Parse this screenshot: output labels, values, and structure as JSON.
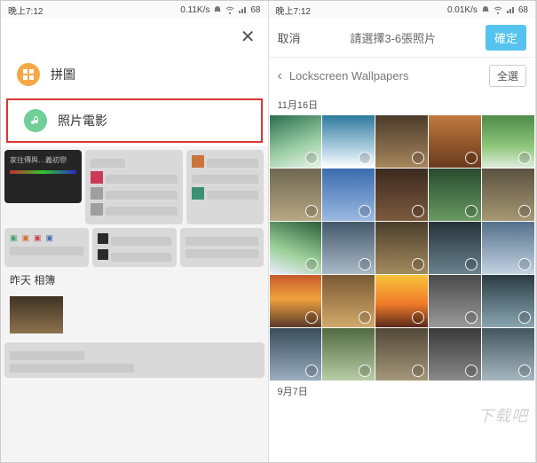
{
  "status": {
    "time": "晚上7:12",
    "speed_left": "0.11K/s",
    "speed_right": "0.01K/s",
    "battery": "68",
    "icons": [
      "do-not-disturb-icon",
      "wifi-icon",
      "signal-icon"
    ]
  },
  "left": {
    "close": "✕",
    "options": [
      {
        "key": "collage",
        "label": "拼圖",
        "icon_color": "orange",
        "icon": "grid-icon",
        "highlighted": false
      },
      {
        "key": "movie",
        "label": "照片電影",
        "icon_color": "green",
        "icon": "music-note-icon",
        "highlighted": true
      }
    ],
    "bg_section": "昨天 相簿"
  },
  "right": {
    "header": {
      "cancel": "取消",
      "title": "請選擇3-6張照片",
      "confirm": "確定"
    },
    "crumb": {
      "back": "‹",
      "path": "Lockscreen  Wallpapers",
      "select_all": "全選"
    },
    "sections": [
      {
        "date": "11月16日",
        "count": 25
      },
      {
        "date": "9月7日",
        "count": 0
      }
    ]
  },
  "watermark": "下载吧"
}
